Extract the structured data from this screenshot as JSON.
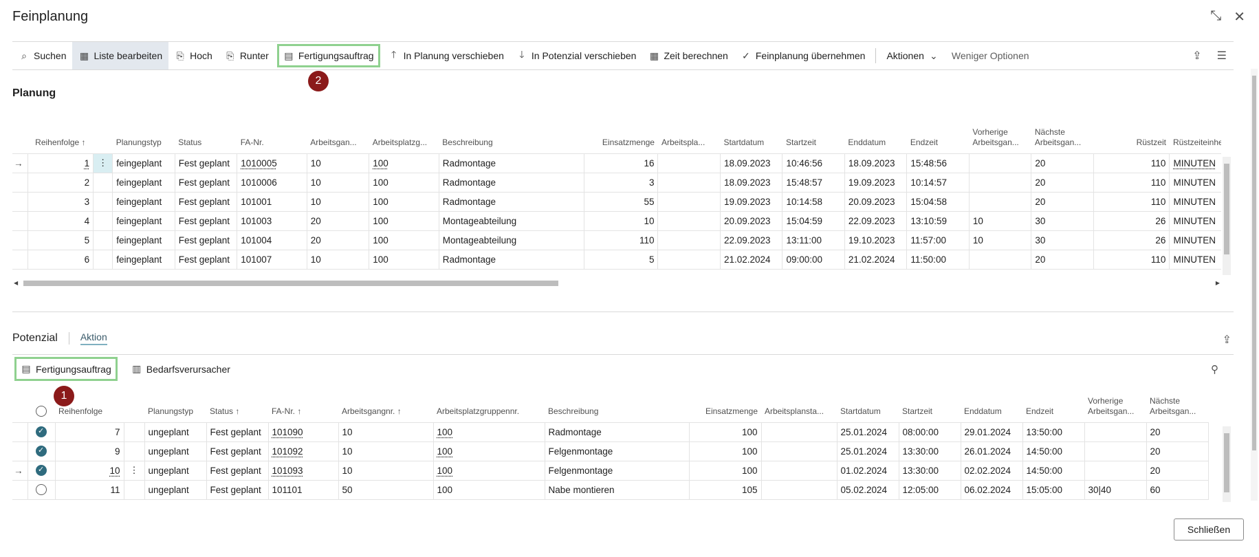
{
  "window": {
    "title": "Feinplanung"
  },
  "toolbar": {
    "items": [
      {
        "label": "Suchen",
        "icon": "search-icon"
      },
      {
        "label": "Liste bearbeiten",
        "icon": "edit-list-icon"
      },
      {
        "label": "Hoch",
        "icon": "move-up-icon"
      },
      {
        "label": "Runter",
        "icon": "move-down-icon"
      },
      {
        "label": "Fertigungsauftrag",
        "icon": "production-order-icon"
      },
      {
        "label": "In Planung verschieben",
        "icon": "arrow-up-icon"
      },
      {
        "label": "In Potenzial verschieben",
        "icon": "arrow-down-icon"
      },
      {
        "label": "Zeit berechnen",
        "icon": "calculator-icon"
      },
      {
        "label": "Feinplanung übernehmen",
        "icon": "checkmark-icon"
      },
      {
        "label": "Aktionen",
        "icon": "chevron-down-icon"
      },
      {
        "label": "Weniger Optionen",
        "icon": ""
      }
    ]
  },
  "badges": {
    "b1": "1",
    "b2": "2"
  },
  "planung": {
    "title": "Planung",
    "headers": [
      "Reihenfolge ↑",
      "",
      "Planungstyp",
      "Status",
      "FA-Nr.",
      "Arbeitsgan...",
      "Arbeitsplatzg...",
      "Beschreibung",
      "Einsatzmenge",
      "Arbeitspla...",
      "Startdatum",
      "Startzeit",
      "Enddatum",
      "Endzeit",
      "Vorherige Arbeitsgan...",
      "Nächste Arbeitsgan...",
      "Rüstzeit",
      "Rüstzeiteinhe..."
    ],
    "rows": [
      [
        "1",
        "⋮",
        "feingeplant",
        "Fest geplant",
        "1010005",
        "10",
        "100",
        "Radmontage",
        "16",
        "",
        "18.09.2023",
        "10:46:56",
        "18.09.2023",
        "15:48:56",
        "",
        "20",
        "110",
        "MINUTEN"
      ],
      [
        "2",
        "",
        "feingeplant",
        "Fest geplant",
        "1010006",
        "10",
        "100",
        "Radmontage",
        "3",
        "",
        "18.09.2023",
        "15:48:57",
        "19.09.2023",
        "10:14:57",
        "",
        "20",
        "110",
        "MINUTEN"
      ],
      [
        "3",
        "",
        "feingeplant",
        "Fest geplant",
        "101001",
        "10",
        "100",
        "Radmontage",
        "55",
        "",
        "19.09.2023",
        "10:14:58",
        "20.09.2023",
        "15:04:58",
        "",
        "20",
        "110",
        "MINUTEN"
      ],
      [
        "4",
        "",
        "feingeplant",
        "Fest geplant",
        "101003",
        "20",
        "100",
        "Montageabteilung",
        "10",
        "",
        "20.09.2023",
        "15:04:59",
        "22.09.2023",
        "13:10:59",
        "10",
        "30",
        "26",
        "MINUTEN"
      ],
      [
        "5",
        "",
        "feingeplant",
        "Fest geplant",
        "101004",
        "20",
        "100",
        "Montageabteilung",
        "110",
        "",
        "22.09.2023",
        "13:11:00",
        "19.10.2023",
        "11:57:00",
        "10",
        "30",
        "26",
        "MINUTEN"
      ],
      [
        "6",
        "",
        "feingeplant",
        "Fest geplant",
        "101007",
        "10",
        "100",
        "Radmontage",
        "5",
        "",
        "21.02.2024",
        "09:00:00",
        "21.02.2024",
        "11:50:00",
        "",
        "20",
        "110",
        "MINUTEN"
      ]
    ]
  },
  "potenzial": {
    "tab1": "Potenzial",
    "tab2": "Aktion",
    "actions": [
      {
        "label": "Fertigungsauftrag",
        "icon": "production-order-icon"
      },
      {
        "label": "Bedarfsverursacher",
        "icon": "demand-source-icon"
      }
    ],
    "headers": [
      "Reihenfolge",
      "",
      "Planungstyp",
      "Status ↑",
      "FA-Nr. ↑",
      "Arbeitsgangnr. ↑",
      "Arbeitsplatzgruppennr.",
      "Beschreibung",
      "Einsatzmenge",
      "Arbeitsplansta...",
      "Startdatum",
      "Startzeit",
      "Enddatum",
      "Endzeit",
      "Vorherige Arbeitsgan...",
      "Nächste Arbeitsgan..."
    ],
    "rows": [
      {
        "checked": true,
        "cells": [
          "7",
          "",
          "ungeplant",
          "Fest geplant",
          "101090",
          "10",
          "100",
          "Radmontage",
          "100",
          "",
          "25.01.2024",
          "08:00:00",
          "29.01.2024",
          "13:50:00",
          "",
          "20"
        ]
      },
      {
        "checked": true,
        "cells": [
          "9",
          "",
          "ungeplant",
          "Fest geplant",
          "101092",
          "10",
          "100",
          "Felgenmontage",
          "100",
          "",
          "25.01.2024",
          "13:30:00",
          "26.01.2024",
          "14:50:00",
          "",
          "20"
        ]
      },
      {
        "checked": true,
        "cells": [
          "10",
          "⋮",
          "ungeplant",
          "Fest geplant",
          "101093",
          "10",
          "100",
          "Felgenmontage",
          "100",
          "",
          "01.02.2024",
          "13:30:00",
          "02.02.2024",
          "14:50:00",
          "",
          "20"
        ]
      },
      {
        "checked": false,
        "cells": [
          "11",
          "",
          "ungeplant",
          "Fest geplant",
          "101101",
          "50",
          "100",
          "Nabe montieren",
          "105",
          "",
          "05.02.2024",
          "12:05:00",
          "06.02.2024",
          "15:05:00",
          "30|40",
          "60"
        ]
      }
    ]
  },
  "footer": {
    "close_label": "Schließen"
  },
  "colors": {
    "highlight": "#8fd18f",
    "badge": "#8b1a1a",
    "check": "#2f6b7e"
  }
}
